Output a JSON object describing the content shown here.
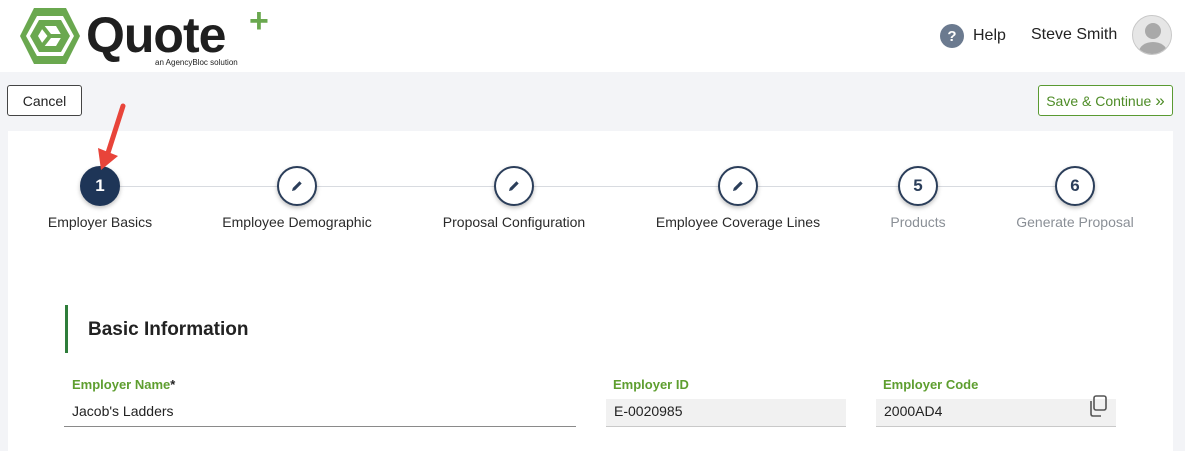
{
  "header": {
    "logo_text": "Quote",
    "logo_plus": "+",
    "logo_tagline": "an AgencyBloc solution",
    "help_label": "Help",
    "help_icon": "?",
    "user_name": "Steve Smith"
  },
  "toolbar": {
    "cancel_label": "Cancel",
    "save_label": "Save & Continue",
    "save_icon": "»"
  },
  "steps": [
    {
      "number": "1",
      "label": "Employer Basics",
      "state": "active"
    },
    {
      "number": "",
      "label": "Employee Demographic",
      "state": "edit"
    },
    {
      "number": "",
      "label": "Proposal Configuration",
      "state": "edit"
    },
    {
      "number": "",
      "label": "Employee Coverage Lines",
      "state": "edit"
    },
    {
      "number": "5",
      "label": "Products",
      "state": "pending"
    },
    {
      "number": "6",
      "label": "Generate Proposal",
      "state": "pending"
    }
  ],
  "section": {
    "title": "Basic Information"
  },
  "fields": {
    "employer_name": {
      "label": "Employer Name",
      "required_mark": "*",
      "value": "Jacob's Ladders"
    },
    "employer_id": {
      "label": "Employer ID",
      "value": "E-0020985"
    },
    "employer_code": {
      "label": "Employer Code",
      "value": "2000AD4"
    }
  },
  "colors": {
    "brand_green": "#6aa84f",
    "navy": "#1e3557",
    "arrow_red": "#e8443a"
  }
}
